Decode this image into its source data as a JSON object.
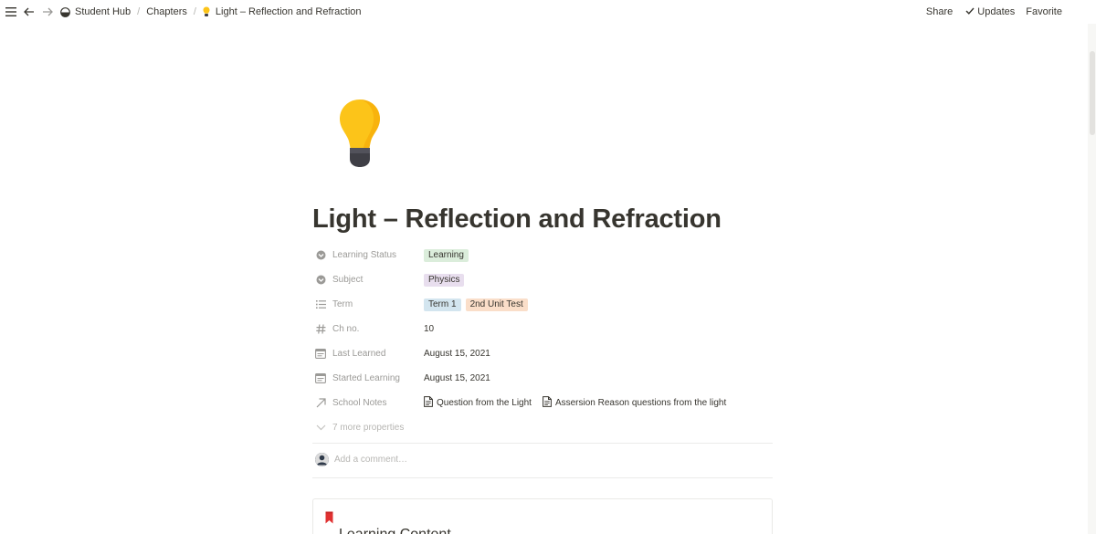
{
  "topbar": {
    "breadcrumbs": [
      "Student Hub",
      "Chapters",
      "Light – Reflection and Refraction"
    ],
    "share": "Share",
    "updates": "Updates",
    "favorite": "Favorite"
  },
  "page": {
    "icon": "lightbulb-icon",
    "title": "Light – Reflection and Refraction",
    "properties": [
      {
        "name": "Learning Status",
        "icon": "status-icon",
        "tags": [
          {
            "label": "Learning",
            "color": "#dbeddb"
          }
        ]
      },
      {
        "name": "Subject",
        "icon": "select-icon",
        "tags": [
          {
            "label": "Physics",
            "color": "#e8deee"
          }
        ]
      },
      {
        "name": "Term",
        "icon": "multiselect-icon",
        "tags": [
          {
            "label": "Term 1",
            "color": "#d3e5ef"
          },
          {
            "label": "2nd Unit Test",
            "color": "#fadec9"
          }
        ]
      },
      {
        "name": "Ch no.",
        "icon": "number-icon",
        "value": "10"
      },
      {
        "name": "Last Learned",
        "icon": "date-icon",
        "value": "August 15, 2021"
      },
      {
        "name": "Started Learning",
        "icon": "date-icon",
        "value": "August 15, 2021"
      },
      {
        "name": "School Notes",
        "icon": "relation-icon",
        "relations": [
          "Question from the Light",
          "Assersion Reason questions from the light"
        ]
      }
    ],
    "more_properties": "7 more properties",
    "comment_placeholder": "Add a comment…",
    "callout_text": "Learning Content"
  },
  "colors": {
    "text": "#37352f",
    "muted": "#9b9a97",
    "bulb": "#fcc419",
    "bulb_base": "#3f3f46"
  }
}
